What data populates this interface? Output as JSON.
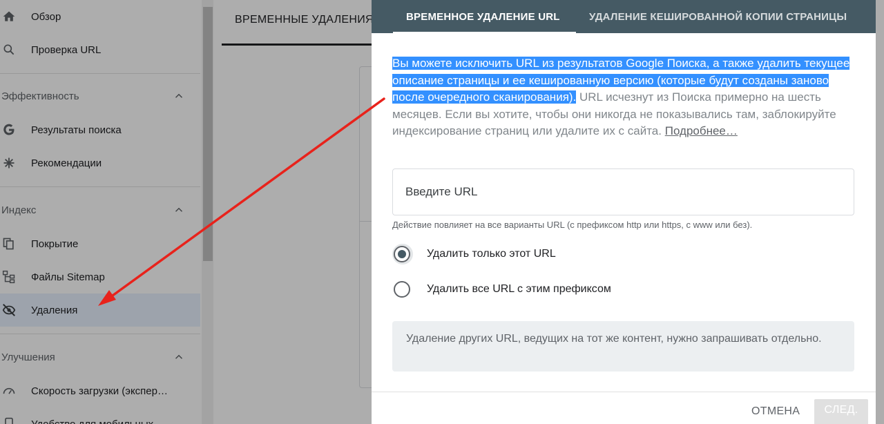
{
  "sidebar": {
    "top_items": [
      {
        "label": "Обзор",
        "icon": "home-icon"
      },
      {
        "label": "Проверка URL",
        "icon": "search-icon"
      }
    ],
    "sections": [
      {
        "label": "Эффективность"
      },
      {
        "label": "Индекс"
      },
      {
        "label": "Улучшения"
      }
    ],
    "performance_items": [
      {
        "label": "Результаты поиска",
        "icon": "google-g-icon"
      },
      {
        "label": "Рекомендации",
        "icon": "asterisk-icon"
      }
    ],
    "index_items": [
      {
        "label": "Покрытие",
        "icon": "coverage-icon"
      },
      {
        "label": "Файлы Sitemap",
        "icon": "sitemap-icon"
      },
      {
        "label": "Удаления",
        "icon": "eye-off-icon",
        "active": true
      }
    ],
    "improvement_items": [
      {
        "label": "Скорость загрузки (экспер…",
        "icon": "speed-icon"
      },
      {
        "label": "Удобство для мобильных",
        "icon": "mobile-icon"
      }
    ]
  },
  "main": {
    "tab_label": "ВРЕМЕННЫЕ УДАЛЕНИЯ"
  },
  "dialog": {
    "tabs": [
      {
        "label": "ВРЕМЕННОЕ УДАЛЕНИЕ URL",
        "selected": true
      },
      {
        "label": "УДАЛЕНИЕ КЕШИРОВАННОЙ КОПИИ СТРАНИЦЫ",
        "selected": false
      }
    ],
    "description_highlighted": "Вы можете исключить URL из результатов Google Поиска, а также удалить текущее описание страницы и ее кешированную версию (которые будут созданы заново после очередного сканирования).",
    "description_rest": " URL исчезнут из Поиска примерно на шесть месяцев. Если вы хотите, чтобы они никогда не показывались там, заблокируйте индексирование страниц или удалите их с сайта. ",
    "more_link": "Подробнее…",
    "url_input": {
      "placeholder": "Введите URL",
      "value": ""
    },
    "hint": "Действие повлияет на все варианты URL (с префиксом http или https, с www или без).",
    "radio_options": [
      {
        "label": "Удалить только этот URL",
        "selected": true
      },
      {
        "label": "Удалить все URL с этим префиксом",
        "selected": false
      }
    ],
    "note": "Удаление других URL, ведущих на тот же контент, нужно запрашивать отдельно.",
    "cancel_label": "ОТМЕНА",
    "next_label": "СЛЕД."
  },
  "colors": {
    "dialog_header": "#455a64",
    "highlight": "#3390ff",
    "annotation_arrow": "#e8221b"
  }
}
